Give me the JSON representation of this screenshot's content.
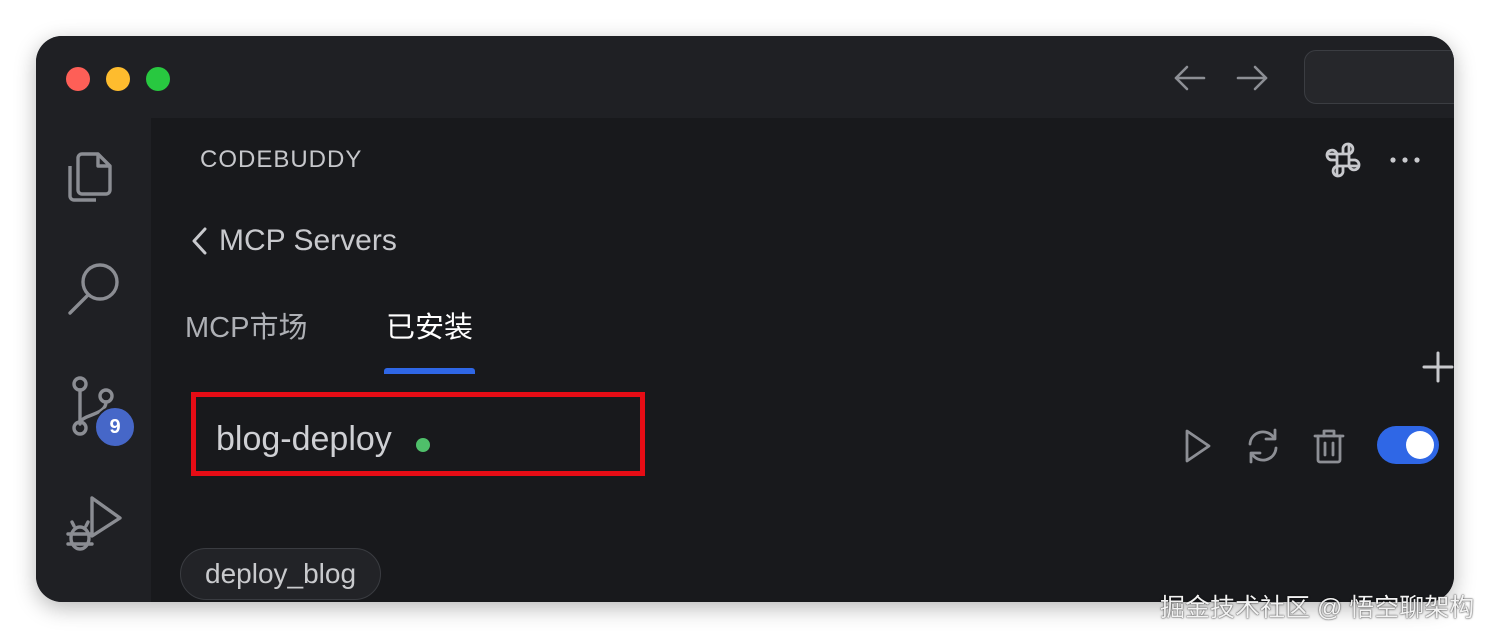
{
  "window": {
    "traffic_lights": {
      "close_color": "#fe5f57",
      "minimize_color": "#febc2e",
      "zoom_color": "#28c840"
    }
  },
  "toolbar": {
    "back_icon": "arrow-left-icon",
    "forward_icon": "arrow-right-icon",
    "search_placeholder": ""
  },
  "activity_bar": {
    "items": [
      {
        "name": "explorer",
        "icon": "files-icon"
      },
      {
        "name": "search",
        "icon": "search-icon"
      },
      {
        "name": "source-control",
        "icon": "git-branch-icon",
        "badge": "9"
      },
      {
        "name": "run-debug",
        "icon": "run-debug-icon"
      }
    ]
  },
  "panel": {
    "title": "CODEBUDDY",
    "header_icons": [
      "integration-icon",
      "more-icon"
    ],
    "back_label": "MCP Servers",
    "tabs": [
      {
        "label": "MCP市场",
        "active": false
      },
      {
        "label": "已安装",
        "active": true
      }
    ],
    "add_icon": "plus-icon",
    "server": {
      "name": "blog-deploy",
      "status_color": "#4fbf6a",
      "enabled": true,
      "actions": [
        "play-icon",
        "refresh-icon",
        "trash-icon"
      ],
      "tools": [
        "deploy_blog"
      ]
    }
  },
  "accent_color": "#2f67e6",
  "highlight_color": "#e60c15",
  "watermark": "掘金技术社区 @ 悟空聊架构"
}
